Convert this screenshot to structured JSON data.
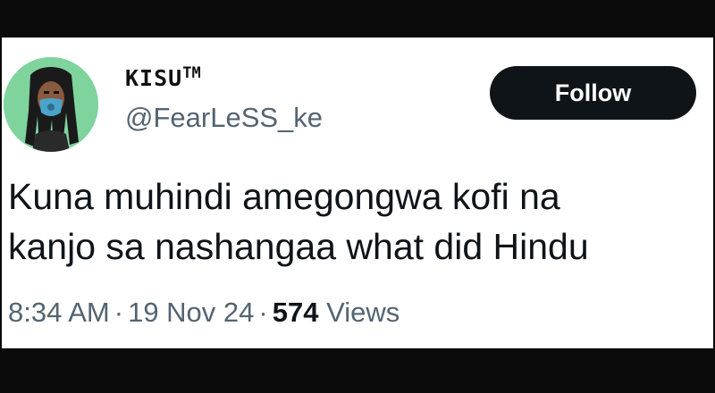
{
  "author": {
    "display_name": "KISU",
    "trademark": "TM",
    "handle": "@FearLeSS_ke",
    "avatar_icon": "profile-avatar"
  },
  "follow_button": {
    "label": "Follow"
  },
  "tweet": {
    "text_lines": [
      "Kuna muhindi amegongwa kofi na",
      "kanjo sa nashangaa what did Hindu"
    ]
  },
  "meta": {
    "time": "8:34 AM",
    "separator": "·",
    "date": "19 Nov 24",
    "views_count": "574",
    "views_label": "Views"
  },
  "colors": {
    "background": "#0b0b0b",
    "card": "#ffffff",
    "button": "#0f1419",
    "muted_text": "#536471",
    "avatar_bg": "#7fd49e"
  }
}
